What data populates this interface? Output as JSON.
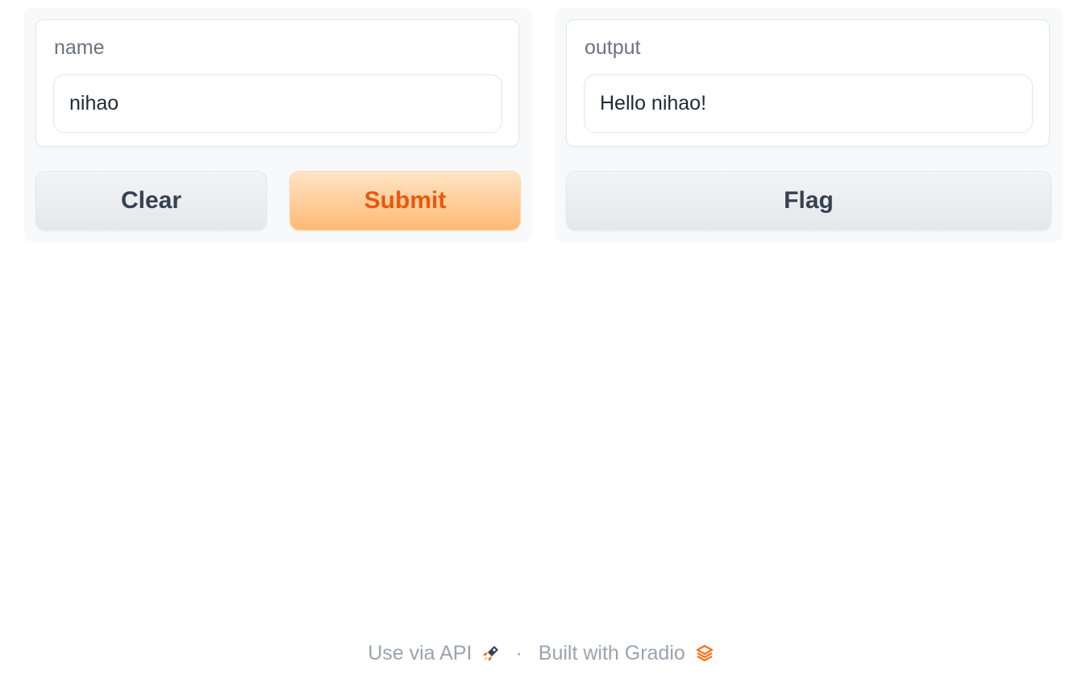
{
  "input_panel": {
    "label": "name",
    "value": "nihao",
    "clear_label": "Clear",
    "submit_label": "Submit"
  },
  "output_panel": {
    "label": "output",
    "value": "Hello nihao!",
    "flag_label": "Flag"
  },
  "footer": {
    "api_link": "Use via API",
    "separator": "·",
    "built_with": "Built with Gradio",
    "api_icon": "rocket-icon",
    "gradio_icon": "gradio-logo-icon"
  },
  "colors": {
    "accent": "#ea580c",
    "primary_button_top": "#ffe4c7",
    "primary_button_bottom": "#fdba74",
    "muted_text": "#9ca3af"
  }
}
